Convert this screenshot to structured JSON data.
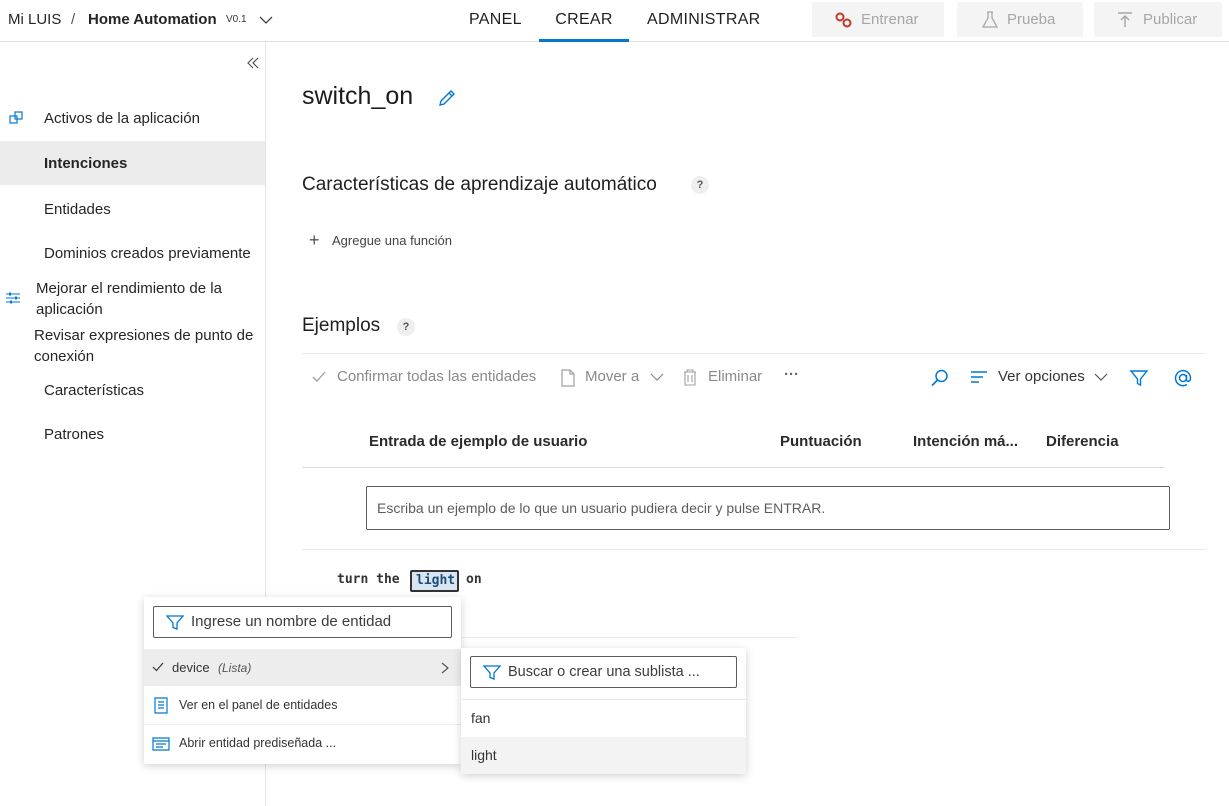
{
  "breadcrumb": {
    "root": "Mi LUIS",
    "separator": "/",
    "app": "Home Automation",
    "version": "V0.1"
  },
  "tabs": [
    {
      "label": "PANEL",
      "active": false
    },
    {
      "label": "CREAR",
      "active": true
    },
    {
      "label": "ADMINISTRAR",
      "active": false
    }
  ],
  "actions": {
    "train": "Entrenar",
    "test": "Prueba",
    "publish": "Publicar"
  },
  "sidebar": {
    "items": [
      {
        "label": "Activos de la aplicación",
        "icon": "assets-icon"
      },
      {
        "label": "Intenciones",
        "selected": true
      },
      {
        "label": "Entidades"
      },
      {
        "label": "Dominios creados previamente"
      },
      {
        "label": "Mejorar el rendimiento de la aplicación",
        "icon": "sliders-icon"
      },
      {
        "label": "Revisar expresiones de punto de conexión"
      },
      {
        "label": "Características"
      },
      {
        "label": "Patrones"
      }
    ]
  },
  "intent": {
    "name": "switch_on"
  },
  "features": {
    "heading": "Características de aprendizaje automático",
    "help": "?",
    "add_label": "Agregue una función"
  },
  "examples": {
    "heading": "Ejemplos",
    "help": "?",
    "toolbar": {
      "confirm_all": "Confirmar todas las entidades",
      "move_to": "Mover a",
      "delete": "Eliminar",
      "more": "···",
      "view_options": "Ver opciones"
    },
    "columns": [
      "Entrada de ejemplo de usuario",
      "Puntuación",
      "Intención má...",
      "Diferencia"
    ],
    "input_placeholder": "Escriba un ejemplo de lo que un usuario pudiera decir y pulse ENTRAR.",
    "utterance": {
      "before": "turn the",
      "selected": "light",
      "after": "on"
    }
  },
  "entity_menu": {
    "search_placeholder": "Ingrese un nombre de entidad",
    "selected_entity": "device",
    "selected_entity_type": "(Lista)",
    "view_in_panel": "Ver en el panel de entidades",
    "open_prebuilt": "Abrir entidad prediseñada ..."
  },
  "sublist_menu": {
    "search_placeholder": "Buscar o crear una sublista ...",
    "items": [
      "fan",
      "light"
    ]
  },
  "colors": {
    "accent": "#0078d4",
    "icon_blue": "#0078d4",
    "train_icon": "#c0392b"
  }
}
